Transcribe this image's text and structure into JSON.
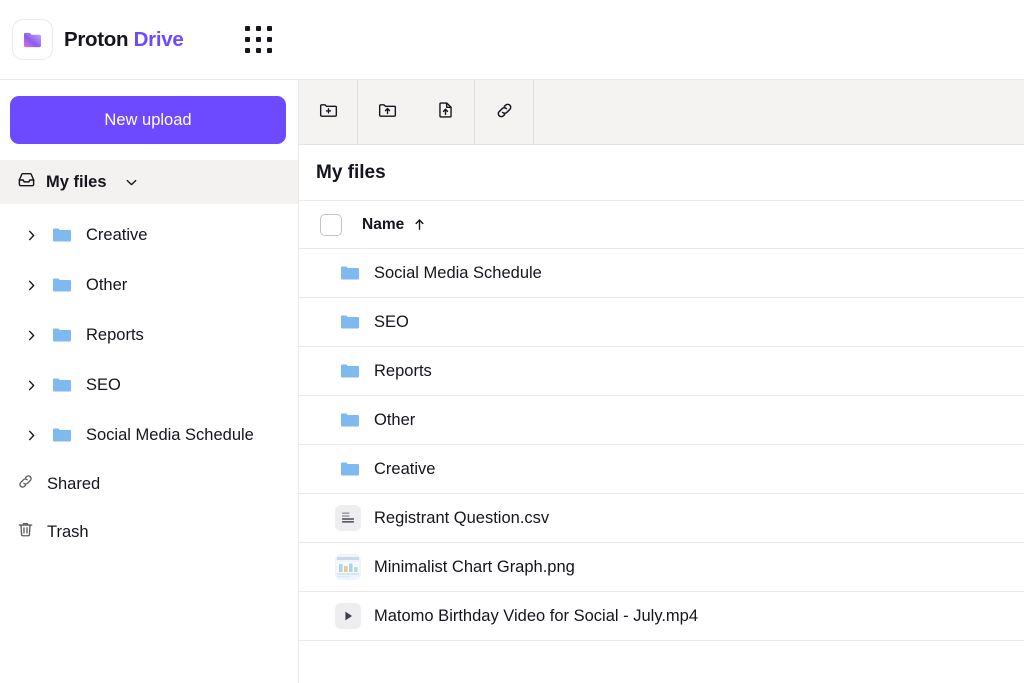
{
  "brand": {
    "name_part1": "Proton",
    "name_part2": "Drive",
    "logo_icon": "folder-gradient-icon",
    "app_grid_icon": "app-grid-icon",
    "accent_color": "#6d4aff",
    "folder_color": "#7eb9ef"
  },
  "sidebar": {
    "new_upload_label": "New upload",
    "my_files": {
      "label": "My files",
      "icon": "inbox-icon",
      "chevron_icon": "chevron-down-icon",
      "selected": true
    },
    "tree": [
      {
        "label": "Creative",
        "icon": "folder-icon",
        "chevron_icon": "chevron-right-icon"
      },
      {
        "label": "Other",
        "icon": "folder-icon",
        "chevron_icon": "chevron-right-icon"
      },
      {
        "label": "Reports",
        "icon": "folder-icon",
        "chevron_icon": "chevron-right-icon"
      },
      {
        "label": "SEO",
        "icon": "folder-icon",
        "chevron_icon": "chevron-right-icon"
      },
      {
        "label": "Social Media Schedule",
        "icon": "folder-icon",
        "chevron_icon": "chevron-right-icon"
      }
    ],
    "nav": [
      {
        "label": "Shared",
        "icon": "link-icon"
      },
      {
        "label": "Trash",
        "icon": "trash-icon"
      }
    ]
  },
  "toolbar": {
    "buttons": [
      {
        "name": "create-folder-button",
        "icon": "folder-plus-icon"
      },
      {
        "name": "upload-folder-button",
        "icon": "folder-upload-icon"
      },
      {
        "name": "upload-file-button",
        "icon": "file-upload-icon"
      },
      {
        "name": "share-link-button",
        "icon": "link-icon"
      }
    ]
  },
  "main": {
    "page_title": "My files",
    "list_header": {
      "select_all_checked": false,
      "name_column": "Name",
      "sort_icon": "arrow-up-icon",
      "sort_direction": "ascending"
    },
    "rows": [
      {
        "name": "Social Media Schedule",
        "type": "folder",
        "icon": "folder-icon"
      },
      {
        "name": "SEO",
        "type": "folder",
        "icon": "folder-icon"
      },
      {
        "name": "Reports",
        "type": "folder",
        "icon": "folder-icon"
      },
      {
        "name": "Other",
        "type": "folder",
        "icon": "folder-icon"
      },
      {
        "name": "Creative",
        "type": "folder",
        "icon": "folder-icon"
      },
      {
        "name": "Registrant Question.csv",
        "type": "csv",
        "icon": "csv-file-icon"
      },
      {
        "name": "Minimalist Chart Graph.png",
        "type": "png",
        "icon": "image-thumbnail-icon"
      },
      {
        "name": "Matomo Birthday Video for Social - July.mp4",
        "type": "mp4",
        "icon": "video-play-icon"
      }
    ]
  }
}
